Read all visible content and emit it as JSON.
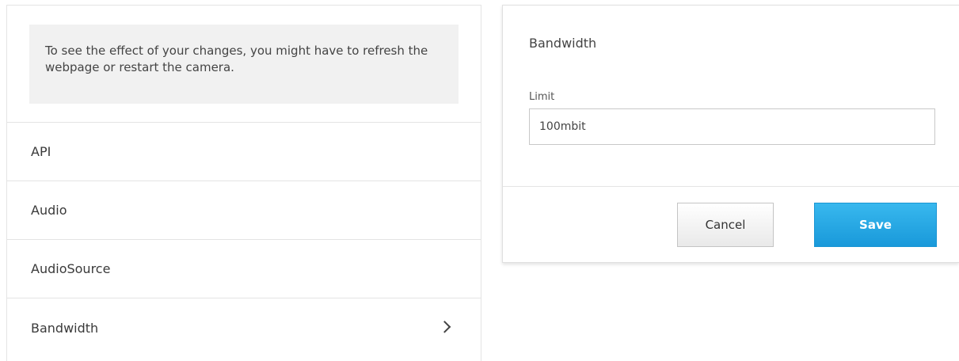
{
  "notice": {
    "text": "To see the effect of your changes, you might have to refresh the webpage or restart the camera."
  },
  "sidebar": {
    "items": [
      {
        "label": "API"
      },
      {
        "label": "Audio"
      },
      {
        "label": "AudioSource"
      },
      {
        "label": "Bandwidth",
        "icon": "chevron-right-icon",
        "selected": true
      }
    ]
  },
  "editor": {
    "title": "Bandwidth",
    "limit_label": "Limit",
    "limit_value": "100mbit",
    "cancel_label": "Cancel",
    "save_label": "Save"
  },
  "colors": {
    "accent": "#1f9fe0",
    "save_text": "#ffffff",
    "notice_bg": "#f1f1f1"
  }
}
